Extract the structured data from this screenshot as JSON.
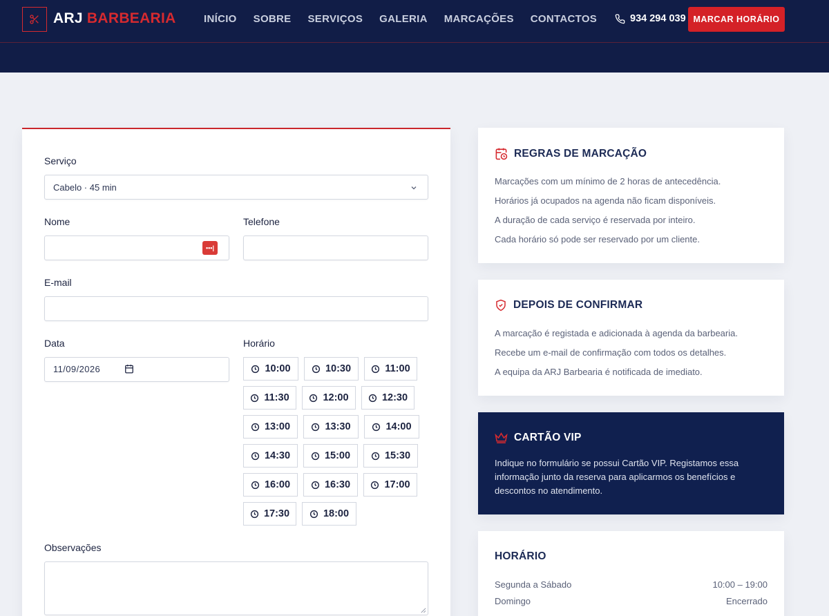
{
  "header": {
    "logo_part1": "ARJ",
    "logo_part2": "BARBEARIA",
    "nav": [
      "INÍCIO",
      "SOBRE",
      "SERVIÇOS",
      "GALERIA",
      "MARCAÇÕES",
      "CONTACTOS"
    ],
    "phone": "934 294 039",
    "cta": "MARCAR HORÁRIO"
  },
  "form": {
    "service_label": "Serviço",
    "service_value": "Cabelo · 45 min",
    "name_label": "Nome",
    "phone_label": "Telefone",
    "email_label": "E-mail",
    "date_label": "Data",
    "date_value": "11/09/2026",
    "time_label": "Horário",
    "slots": [
      "10:00",
      "10:30",
      "11:00",
      "11:30",
      "12:00",
      "12:30",
      "13:00",
      "13:30",
      "14:00",
      "14:30",
      "15:00",
      "15:30",
      "16:00",
      "16:30",
      "17:00",
      "17:30",
      "18:00"
    ],
    "notes_label": "Observações"
  },
  "rules": {
    "title": "REGRAS DE MARCAÇÃO",
    "lines": [
      "Marcações com um mínimo de 2 horas de antecedência.",
      "Horários já ocupados na agenda não ficam disponíveis.",
      "A duração de cada serviço é reservada por inteiro.",
      "Cada horário só pode ser reservado por um cliente."
    ]
  },
  "after": {
    "title": "DEPOIS DE CONFIRMAR",
    "lines": [
      "A marcação é registada e adicionada à agenda da barbearia.",
      "Recebe um e-mail de confirmação com todos os detalhes.",
      "A equipa da ARJ Barbearia é notificada de imediato."
    ]
  },
  "vip": {
    "title": "CARTÃO VIP",
    "text": "Indique no formulário se possui Cartão VIP. Registamos essa informação junto da reserva para aplicarmos os benefícios e descontos no atendimento."
  },
  "hours": {
    "title": "HORÁRIO",
    "rows": [
      {
        "day": "Segunda a Sábado",
        "time": "10:00 – 19:00"
      },
      {
        "day": "Domingo",
        "time": "Encerrado"
      }
    ]
  },
  "colors": {
    "navy": "#111d47",
    "accent_red": "#d42127",
    "background": "#eef0f5"
  },
  "icons": {
    "logo": "scissors-icon",
    "phone": "phone-icon",
    "rules": "calendar-clock-icon",
    "after": "shield-check-icon",
    "vip": "crown-icon",
    "slot": "clock-icon"
  }
}
